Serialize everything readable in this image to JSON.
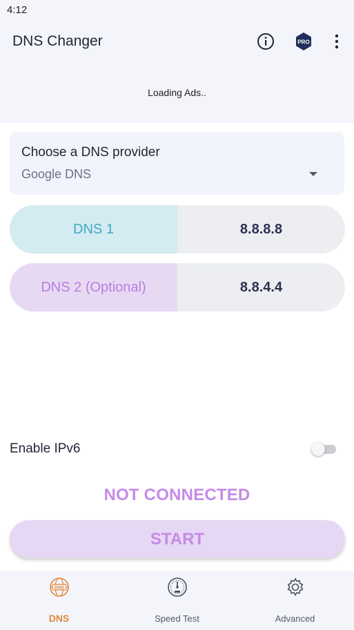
{
  "status_bar": {
    "time": "4:12"
  },
  "app_bar": {
    "title": "DNS Changer",
    "info_icon": "info-icon",
    "pro_badge": "PRO",
    "more_icon": "more-vert-icon"
  },
  "ad": {
    "text": "Loading Ads.."
  },
  "provider": {
    "label": "Choose a DNS provider",
    "selected": "Google DNS"
  },
  "dns1": {
    "label": "DNS 1",
    "value": "8.8.8.8"
  },
  "dns2": {
    "label": "DNS 2 (Optional)",
    "value": "8.8.4.4"
  },
  "ipv6": {
    "label": "Enable IPv6",
    "enabled": false
  },
  "connection": {
    "status": "NOT CONNECTED"
  },
  "start_button": {
    "label": "START"
  },
  "bottom_nav": [
    {
      "label": "DNS",
      "icon": "dns-globe-icon",
      "active": true
    },
    {
      "label": "Speed Test",
      "icon": "speedometer-icon",
      "active": false
    },
    {
      "label": "Advanced",
      "icon": "gear-icon",
      "active": false
    }
  ],
  "colors": {
    "accent_purple": "#c58ae8",
    "dns1_cyan": "#3fa7c0",
    "active_nav": "#e0863a"
  }
}
